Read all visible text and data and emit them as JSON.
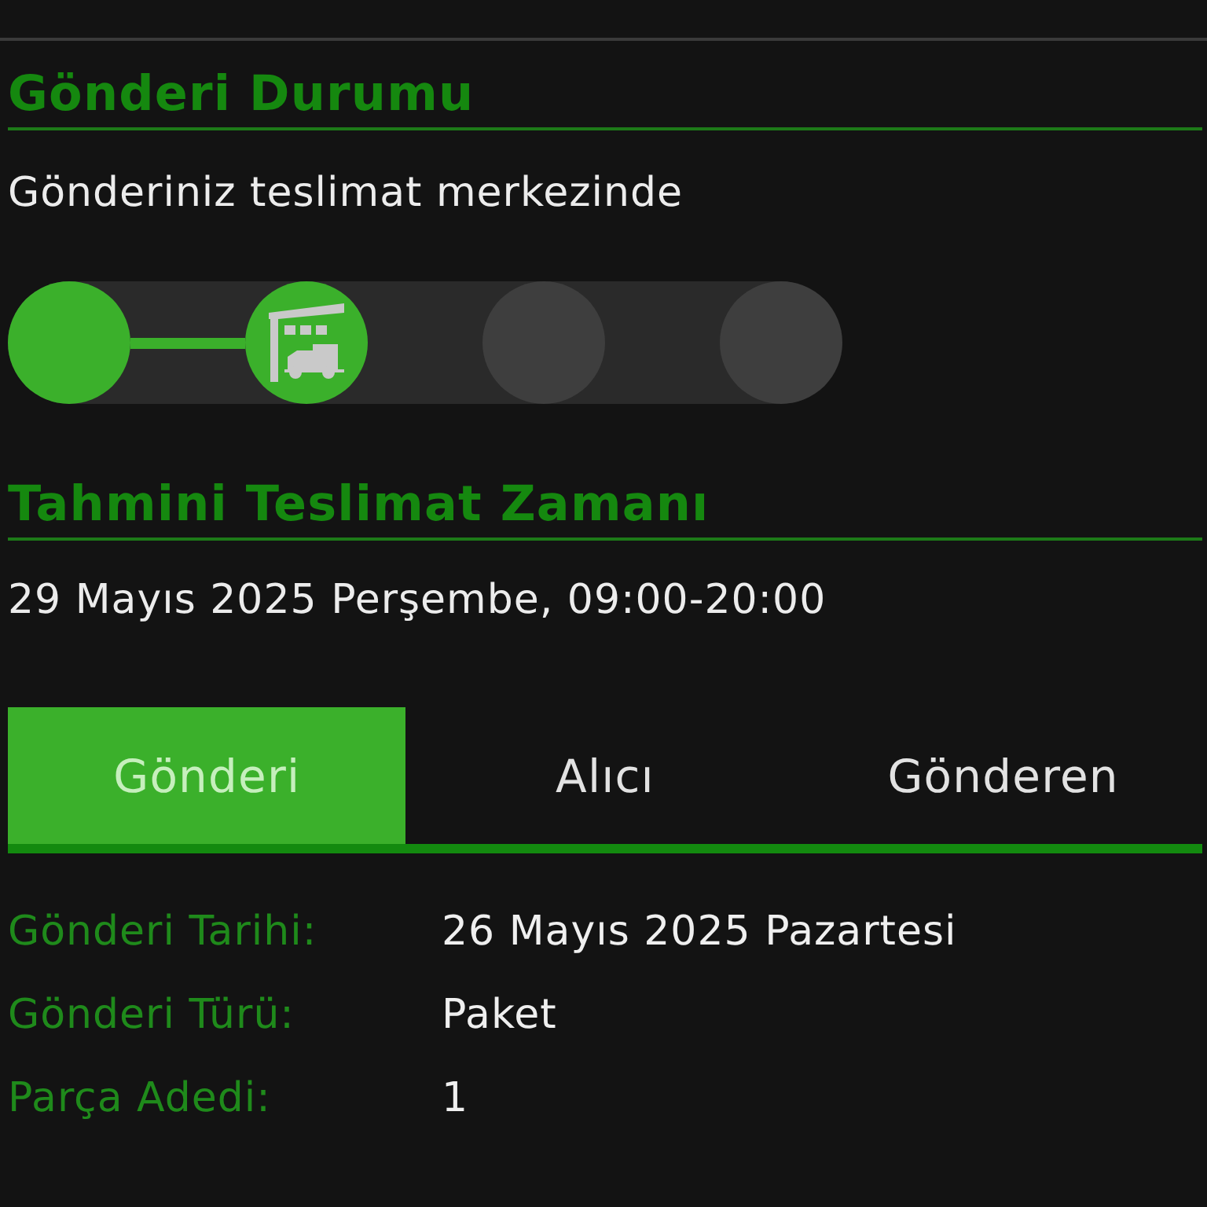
{
  "status": {
    "title": "Gönderi Durumu",
    "message": "Gönderiniz teslimat merkezinde",
    "steps": [
      {
        "completed": true,
        "current": false
      },
      {
        "completed": true,
        "current": true
      },
      {
        "completed": false,
        "current": false
      },
      {
        "completed": false,
        "current": false
      }
    ]
  },
  "delivery_estimate": {
    "title": "Tahmini Teslimat Zamanı",
    "value": "29 Mayıs 2025 Perşembe, 09:00-20:00"
  },
  "tabs": [
    {
      "label": "Gönderi",
      "selected": true
    },
    {
      "label": "Alıcı",
      "selected": false
    },
    {
      "label": "Gönderen",
      "selected": false
    }
  ],
  "details": [
    {
      "label": "Gönderi Tarihi:",
      "value": "26 Mayıs 2025 Pazartesi"
    },
    {
      "label": "Gönderi Türü:",
      "value": "Paket"
    },
    {
      "label": "Parça Adedi:",
      "value": "1"
    }
  ]
}
